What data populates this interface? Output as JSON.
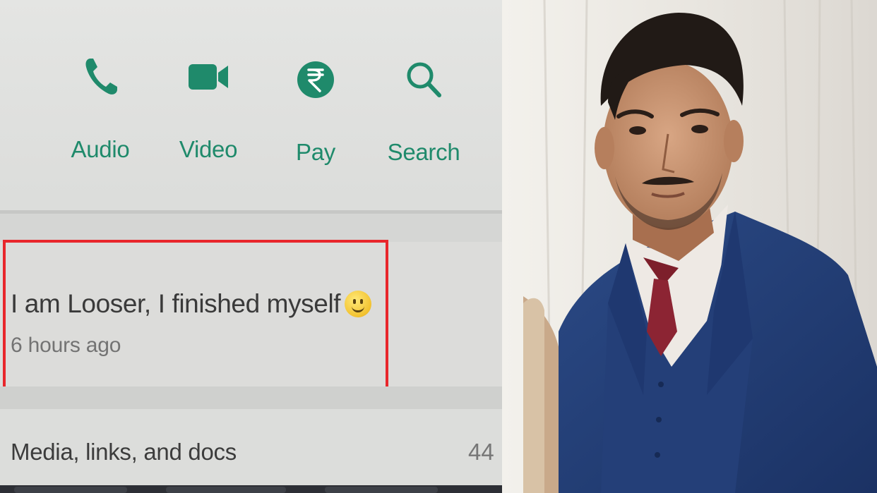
{
  "contact_actions": [
    {
      "label": "Audio",
      "icon": "phone-icon"
    },
    {
      "label": "Video",
      "icon": "video-camera-icon"
    },
    {
      "label": "Pay",
      "icon": "rupee-icon"
    },
    {
      "label": "Search",
      "icon": "search-icon"
    }
  ],
  "about": {
    "text": "I am Looser, I finished myself",
    "emoji": "slightly-smiling-face-icon",
    "time": "6 hours ago"
  },
  "media": {
    "label": "Media, links, and docs",
    "count": "44"
  },
  "colors": {
    "accent": "#1f8a6b",
    "highlight_border": "#e8262b"
  }
}
